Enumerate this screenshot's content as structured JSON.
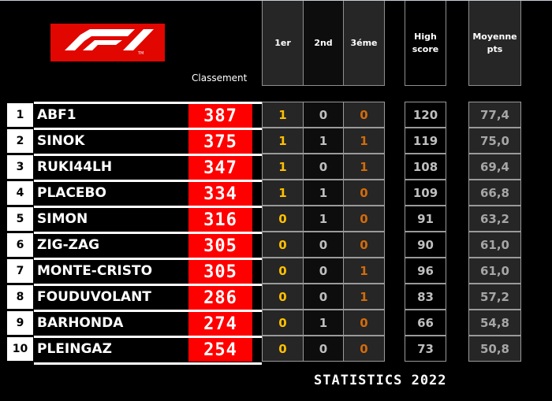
{
  "logo": {
    "name": "F1",
    "trademark": "TM",
    "brand_color": "#e10600"
  },
  "header": {
    "classement": "Classement",
    "first": "1er",
    "second": "2nd",
    "third": "3éme",
    "high_score_line1": "High",
    "high_score_line2": "score",
    "moyenne_line1": "Moyenne",
    "moyenne_line2": "pts"
  },
  "rows": [
    {
      "rank": "1",
      "name": "ABF1",
      "score": "387",
      "first": "1",
      "second": "0",
      "third": "0",
      "high": "120",
      "avg": "77,4"
    },
    {
      "rank": "2",
      "name": "SINOK",
      "score": "375",
      "first": "1",
      "second": "1",
      "third": "1",
      "high": "119",
      "avg": "75,0"
    },
    {
      "rank": "3",
      "name": "RUKI44LH",
      "score": "347",
      "first": "1",
      "second": "0",
      "third": "1",
      "high": "108",
      "avg": "69,4"
    },
    {
      "rank": "4",
      "name": "PLACEBO",
      "score": "334",
      "first": "1",
      "second": "1",
      "third": "0",
      "high": "109",
      "avg": "66,8"
    },
    {
      "rank": "5",
      "name": "SIMON",
      "score": "316",
      "first": "0",
      "second": "1",
      "third": "0",
      "high": "91",
      "avg": "63,2"
    },
    {
      "rank": "6",
      "name": "ZIG-ZAG",
      "score": "305",
      "first": "0",
      "second": "0",
      "third": "0",
      "high": "90",
      "avg": "61,0"
    },
    {
      "rank": "7",
      "name": "MONTE-CRISTO",
      "score": "305",
      "first": "0",
      "second": "0",
      "third": "1",
      "high": "96",
      "avg": "61,0"
    },
    {
      "rank": "8",
      "name": "FOUDUVOLANT",
      "score": "286",
      "first": "0",
      "second": "0",
      "third": "1",
      "high": "83",
      "avg": "57,2"
    },
    {
      "rank": "9",
      "name": "BARHONDA",
      "score": "274",
      "first": "0",
      "second": "1",
      "third": "0",
      "high": "66",
      "avg": "54,8"
    },
    {
      "rank": "10",
      "name": "PLEINGAZ",
      "score": "254",
      "first": "0",
      "second": "0",
      "third": "0",
      "high": "73",
      "avg": "50,8"
    }
  ],
  "footer": {
    "title": "STATISTICS 2022"
  },
  "colors": {
    "score_bg": "#ff0000",
    "first": "#ffc000",
    "second": "#bfbfbf",
    "third": "#d26c0a",
    "avg": "#a6a6a6"
  }
}
